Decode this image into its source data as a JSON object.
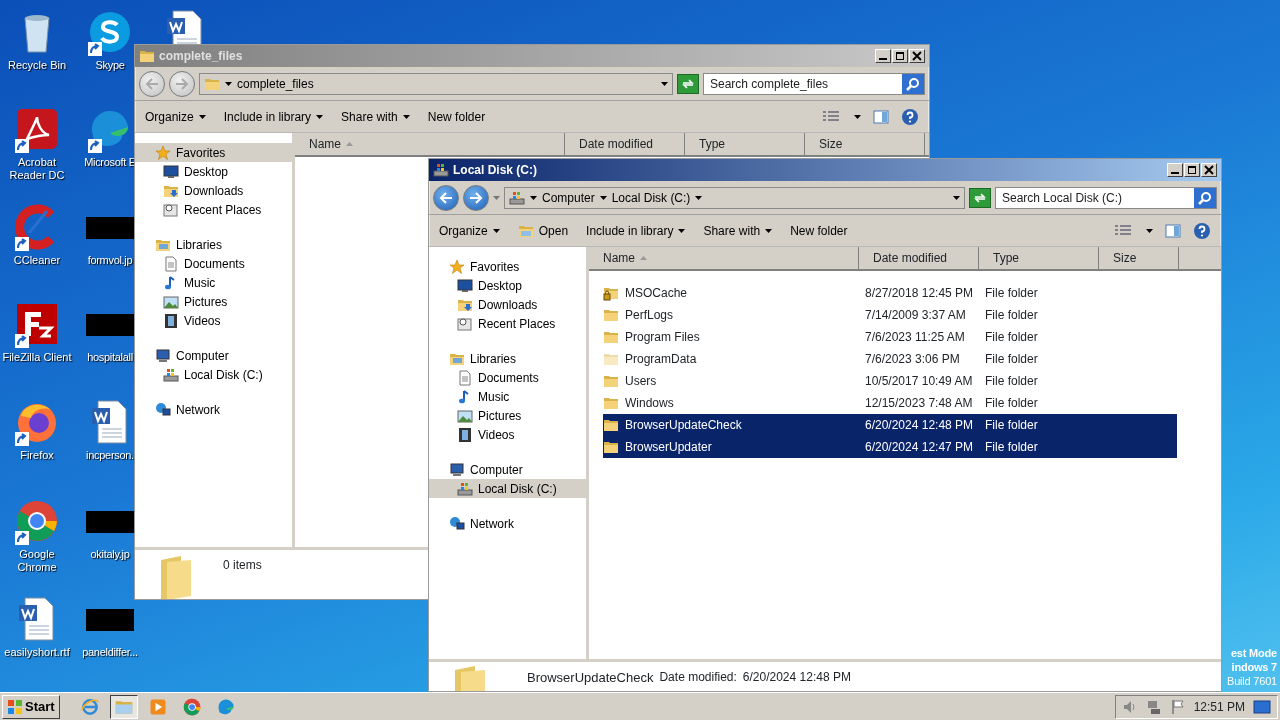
{
  "desktop_icons": [
    {
      "label": "Recycle Bin",
      "kind": "recycle",
      "shortcut": false
    },
    {
      "label": "Acrobat Reader DC",
      "kind": "acrobat",
      "shortcut": true
    },
    {
      "label": "CCleaner",
      "kind": "ccleaner",
      "shortcut": true
    },
    {
      "label": "FileZilla Client",
      "kind": "filezilla",
      "shortcut": true
    },
    {
      "label": "Firefox",
      "kind": "firefox",
      "shortcut": true
    },
    {
      "label": "Google Chrome",
      "kind": "chrome",
      "shortcut": true
    },
    {
      "label": "easilyshort.rtf",
      "kind": "word",
      "shortcut": false
    },
    {
      "label": "Skype",
      "kind": "skype",
      "shortcut": true
    },
    {
      "label": "Microsoft E",
      "kind": "edge",
      "shortcut": true
    },
    {
      "label": "formvol.jp",
      "kind": "thumbnail",
      "shortcut": false
    },
    {
      "label": "hospitalall",
      "kind": "thumbnail",
      "shortcut": false
    },
    {
      "label": "incperson.",
      "kind": "word",
      "shortcut": false
    },
    {
      "label": "okitaly.jp",
      "kind": "thumbnail",
      "shortcut": false
    },
    {
      "label": "paneldiffer...",
      "kind": "thumbnail",
      "shortcut": false
    },
    {
      "kind": "word",
      "shortcut": false
    }
  ],
  "desktop_notice": [
    "est Mode",
    "indows 7",
    "Build 7601"
  ],
  "windows": [
    {
      "title": "complete_files",
      "active": false,
      "breadcrumb": [
        {
          "label": "complete_files",
          "kind": "folder"
        }
      ],
      "search": {
        "placeholder": "Search complete_files"
      },
      "toolbar": [
        {
          "label": "Organize",
          "dropdown": true,
          "has_icon": false
        },
        {
          "label": "Include in library",
          "dropdown": true,
          "has_icon": false
        },
        {
          "label": "Share with",
          "dropdown": true,
          "has_icon": false
        },
        {
          "label": "New folder",
          "dropdown": false,
          "has_icon": false
        }
      ],
      "nav": [
        {
          "label": "Favorites",
          "kind": "star",
          "selected": true,
          "children": [
            {
              "label": "Desktop",
              "kind": "desktop",
              "selected": false
            },
            {
              "label": "Downloads",
              "kind": "downloads",
              "selected": false
            },
            {
              "label": "Recent Places",
              "kind": "recent",
              "selected": false
            }
          ]
        },
        {
          "label": "Libraries",
          "kind": "libraries",
          "selected": false,
          "children": [
            {
              "label": "Documents",
              "kind": "documents",
              "selected": false
            },
            {
              "label": "Music",
              "kind": "music",
              "selected": false
            },
            {
              "label": "Pictures",
              "kind": "pictures",
              "selected": false
            },
            {
              "label": "Videos",
              "kind": "videos",
              "selected": false
            }
          ]
        },
        {
          "label": "Computer",
          "kind": "computer",
          "selected": false,
          "children": [
            {
              "label": "Local Disk (C:)",
              "kind": "drive",
              "selected": false
            }
          ]
        },
        {
          "label": "Network",
          "kind": "network",
          "selected": false
        }
      ],
      "columns": [
        {
          "label": "Name",
          "sorted": true
        },
        {
          "label": "Date modified",
          "sorted": false
        },
        {
          "label": "Type",
          "sorted": false
        },
        {
          "label": "Size",
          "sorted": false
        }
      ],
      "details": {
        "text": "0 items"
      }
    },
    {
      "title": "Local Disk (C:)",
      "active": true,
      "breadcrumb": [
        {
          "label": "Computer",
          "kind": "drive"
        },
        {
          "label": "Local Disk (C:)",
          "kind": "crumb"
        }
      ],
      "search": {
        "placeholder": "Search Local Disk (C:)"
      },
      "toolbar": [
        {
          "label": "Organize",
          "dropdown": true,
          "has_icon": false
        },
        {
          "label": "Open",
          "dropdown": false,
          "has_icon": true
        },
        {
          "label": "Include in library",
          "dropdown": true,
          "has_icon": false
        },
        {
          "label": "Share with",
          "dropdown": true,
          "has_icon": false
        },
        {
          "label": "New folder",
          "dropdown": false,
          "has_icon": false
        }
      ],
      "nav": [
        {
          "label": "Favorites",
          "kind": "star",
          "selected": false,
          "children": [
            {
              "label": "Desktop",
              "kind": "desktop",
              "selected": false
            },
            {
              "label": "Downloads",
              "kind": "downloads",
              "selected": false
            },
            {
              "label": "Recent Places",
              "kind": "recent",
              "selected": false
            }
          ]
        },
        {
          "label": "Libraries",
          "kind": "libraries",
          "selected": false,
          "children": [
            {
              "label": "Documents",
              "kind": "documents",
              "selected": false
            },
            {
              "label": "Music",
              "kind": "music",
              "selected": false
            },
            {
              "label": "Pictures",
              "kind": "pictures",
              "selected": false
            },
            {
              "label": "Videos",
              "kind": "videos",
              "selected": false
            }
          ]
        },
        {
          "label": "Computer",
          "kind": "computer",
          "selected": false,
          "children": [
            {
              "label": "Local Disk (C:)",
              "kind": "drive",
              "selected": true
            }
          ]
        },
        {
          "label": "Network",
          "kind": "network",
          "selected": false
        }
      ],
      "columns": [
        {
          "label": "Name",
          "sorted": true
        },
        {
          "label": "Date modified",
          "sorted": false
        },
        {
          "label": "Type",
          "sorted": false
        },
        {
          "label": "Size",
          "sorted": false
        }
      ],
      "files": [
        {
          "name": "MSOCache",
          "date": "8/27/2018 12:45 PM",
          "type": "File folder",
          "selected": false,
          "hidden": false,
          "locked": true
        },
        {
          "name": "PerfLogs",
          "date": "7/14/2009 3:37 AM",
          "type": "File folder",
          "selected": false,
          "hidden": false,
          "locked": false
        },
        {
          "name": "Program Files",
          "date": "7/6/2023 11:25 AM",
          "type": "File folder",
          "selected": false,
          "hidden": false,
          "locked": false
        },
        {
          "name": "ProgramData",
          "date": "7/6/2023 3:06 PM",
          "type": "File folder",
          "selected": false,
          "hidden": true,
          "locked": false
        },
        {
          "name": "Users",
          "date": "10/5/2017 10:49 AM",
          "type": "File folder",
          "selected": false,
          "hidden": false,
          "locked": false
        },
        {
          "name": "Windows",
          "date": "12/15/2023 7:48 AM",
          "type": "File folder",
          "selected": false,
          "hidden": false,
          "locked": false
        },
        {
          "name": "BrowserUpdateCheck",
          "date": "6/20/2024 12:48 PM",
          "type": "File folder",
          "selected": true,
          "hidden": false,
          "locked": false
        },
        {
          "name": "BrowserUpdater",
          "date": "6/20/2024 12:47 PM",
          "type": "File folder",
          "selected": true,
          "hidden": false,
          "locked": false
        }
      ],
      "details": {
        "name": "BrowserUpdateCheck",
        "label": "Date modified:",
        "value": "6/20/2024 12:48 PM"
      }
    }
  ],
  "taskbar": {
    "start": "Start",
    "apps": [
      {
        "kind": "ie",
        "selected": false
      },
      {
        "kind": "explorer",
        "selected": true
      },
      {
        "kind": "media",
        "selected": false
      },
      {
        "kind": "chrome",
        "selected": false
      },
      {
        "kind": "edge",
        "selected": false
      }
    ],
    "clock": "12:51 PM"
  }
}
